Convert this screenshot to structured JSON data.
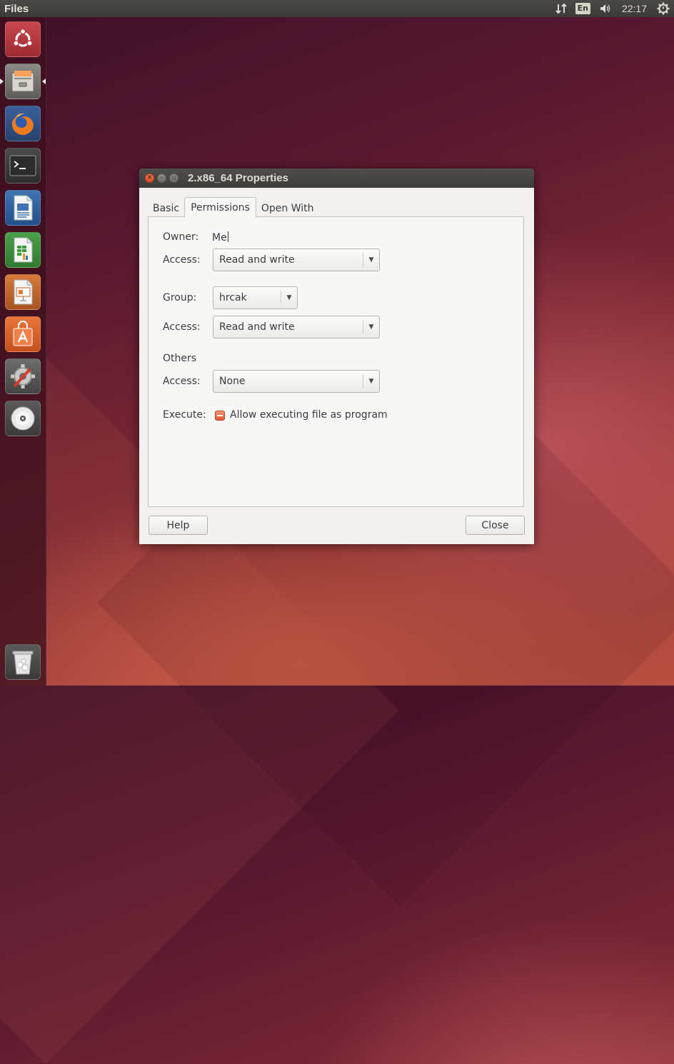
{
  "top_panel": {
    "app_title": "Files",
    "indicators": {
      "network_icon": "network-transfer-icon",
      "keyboard_layout": "En",
      "sound_icon": "sound-volume-icon",
      "clock": "22:17",
      "session_icon": "gear-power-icon"
    }
  },
  "launcher": {
    "items": [
      {
        "name": "ubuntu-dash-icon"
      },
      {
        "name": "files-icon",
        "running": true,
        "active": true
      },
      {
        "name": "firefox-icon"
      },
      {
        "name": "terminal-icon"
      },
      {
        "name": "libreoffice-writer-icon"
      },
      {
        "name": "libreoffice-calc-icon"
      },
      {
        "name": "libreoffice-impress-icon"
      },
      {
        "name": "software-center-icon"
      },
      {
        "name": "system-settings-icon"
      },
      {
        "name": "dvd-icon"
      },
      {
        "name": "trash-icon"
      }
    ]
  },
  "dialog": {
    "title": "2.x86_64 Properties",
    "tabs": [
      {
        "label": "Basic",
        "active": false
      },
      {
        "label": "Permissions",
        "active": true
      },
      {
        "label": "Open With",
        "active": false
      }
    ],
    "permissions": {
      "owner_label": "Owner:",
      "owner_value": "Me",
      "owner_access_label": "Access:",
      "owner_access_value": "Read and write",
      "group_label": "Group:",
      "group_value": "hrcak",
      "group_access_label": "Access:",
      "group_access_value": "Read and write",
      "others_label": "Others",
      "others_access_label": "Access:",
      "others_access_value": "None",
      "execute_label": "Execute:",
      "execute_checkbox_label": "Allow executing file as program",
      "execute_state": "indeterminate"
    },
    "buttons": {
      "help": "Help",
      "close": "Close"
    }
  },
  "colors": {
    "accent_orange": "#dd4814",
    "panel_dark": "#3c3b37",
    "dialog_bg": "#f2f1f0"
  }
}
